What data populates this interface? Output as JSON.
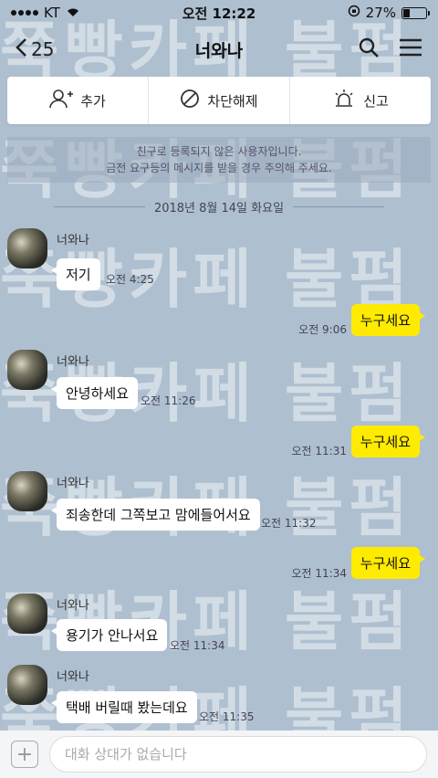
{
  "status_bar": {
    "carrier": "KT",
    "time": "오전 12:22",
    "battery": "27%"
  },
  "nav": {
    "back_count": "25",
    "title": "너와나"
  },
  "actions": {
    "add": "추가",
    "unblock": "차단해제",
    "report": "신고"
  },
  "notice": {
    "line1": "친구로 등록되지 않은 사용자입니다.",
    "line2": "금전 요구등의 메시지를 받을 경우 주의해 주세요."
  },
  "date_separator": "2018년 8월 14일 화요일",
  "watermark": "쭉빵카페 불펌 금지",
  "messages": [
    {
      "sender": "너와나",
      "text": "저기",
      "time": "오전 4:25"
    },
    {
      "text": "누구세요",
      "time": "오전 9:06"
    },
    {
      "sender": "너와나",
      "text": "안녕하세요",
      "time": "오전 11:26"
    },
    {
      "text": "누구세요",
      "time": "오전 11:31"
    },
    {
      "sender": "너와나",
      "text": "죄송한데 그쪽보고 맘에들어서요",
      "time": "오전 11:32"
    },
    {
      "text": "누구세요",
      "time": "오전 11:34"
    },
    {
      "sender": "너와나",
      "text": "용기가 안나서요",
      "time": "오전 11:34"
    },
    {
      "sender": "너와나",
      "text": "택배 버릴때 봤는데요",
      "time": "오전 11:35"
    }
  ],
  "input": {
    "placeholder": "대화 상대가 없습니다"
  },
  "colors": {
    "background": "#aebfd0",
    "outgoing_bubble": "#ffeb00",
    "incoming_bubble": "#ffffff"
  }
}
